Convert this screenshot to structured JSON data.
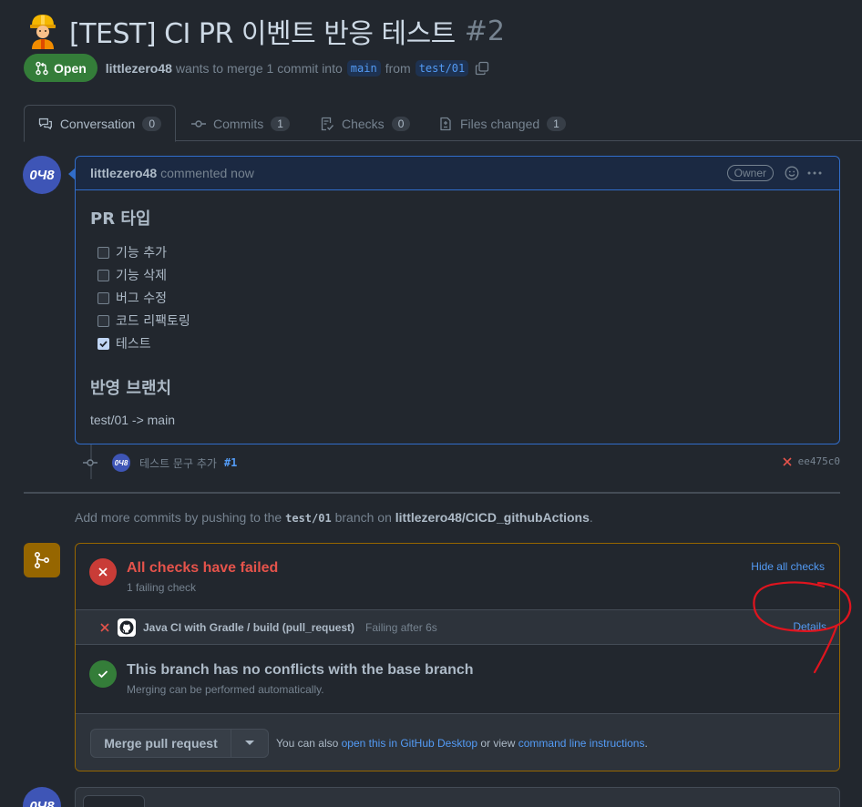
{
  "pr": {
    "title": "[TEST] CI PR 이벤트 반응 테스트",
    "number": "#2",
    "status": "Open",
    "author": "littlezero48",
    "merge_text": "wants to merge 1 commit into",
    "base_branch": "main",
    "from_text": "from",
    "head_branch": "test/01"
  },
  "tabs": [
    {
      "label": "Conversation",
      "count": "0"
    },
    {
      "label": "Commits",
      "count": "1"
    },
    {
      "label": "Checks",
      "count": "0"
    },
    {
      "label": "Files changed",
      "count": "1"
    }
  ],
  "comment": {
    "author": "littlezero48",
    "meta": "commented now",
    "role": "Owner",
    "heading1": "PR 타입",
    "tasks": [
      {
        "label": "기능 추가",
        "checked": false
      },
      {
        "label": "기능 삭제",
        "checked": false
      },
      {
        "label": "버그 수정",
        "checked": false
      },
      {
        "label": "코드 리팩토링",
        "checked": false
      },
      {
        "label": "테스트",
        "checked": true
      }
    ],
    "heading2": "반영 브랜치",
    "branch_line": "test/01 -> main"
  },
  "commit": {
    "message": "테스트 문구 추가",
    "ref": "#1",
    "sha": "ee475c0"
  },
  "hint": {
    "prefix": "Add more commits by pushing to the",
    "branch": "test/01",
    "middle": "branch on",
    "repo": "littlezero48/CICD_githubActions",
    "suffix": "."
  },
  "checks": {
    "title": "All checks have failed",
    "subtitle": "1 failing check",
    "hide_label": "Hide all checks",
    "item_name": "Java CI with Gradle / build (pull_request)",
    "item_status": "Failing after 6s",
    "details_label": "Details",
    "conflict_title": "This branch has no conflicts with the base branch",
    "conflict_sub": "Merging can be performed automatically."
  },
  "merge": {
    "button_label": "Merge pull request",
    "note_prefix": "You can also",
    "desktop_link": "open this in GitHub Desktop",
    "note_middle": "or view",
    "cli_link": "command line instructions",
    "note_suffix": "."
  },
  "avatar_text": "0Ч8",
  "colors": {
    "background": "#22272e",
    "open_green": "#347d39",
    "fail_red": "#e5534b",
    "link_blue": "#539bf5",
    "warning_border": "#966600",
    "annotation_red": "#e0141e"
  }
}
